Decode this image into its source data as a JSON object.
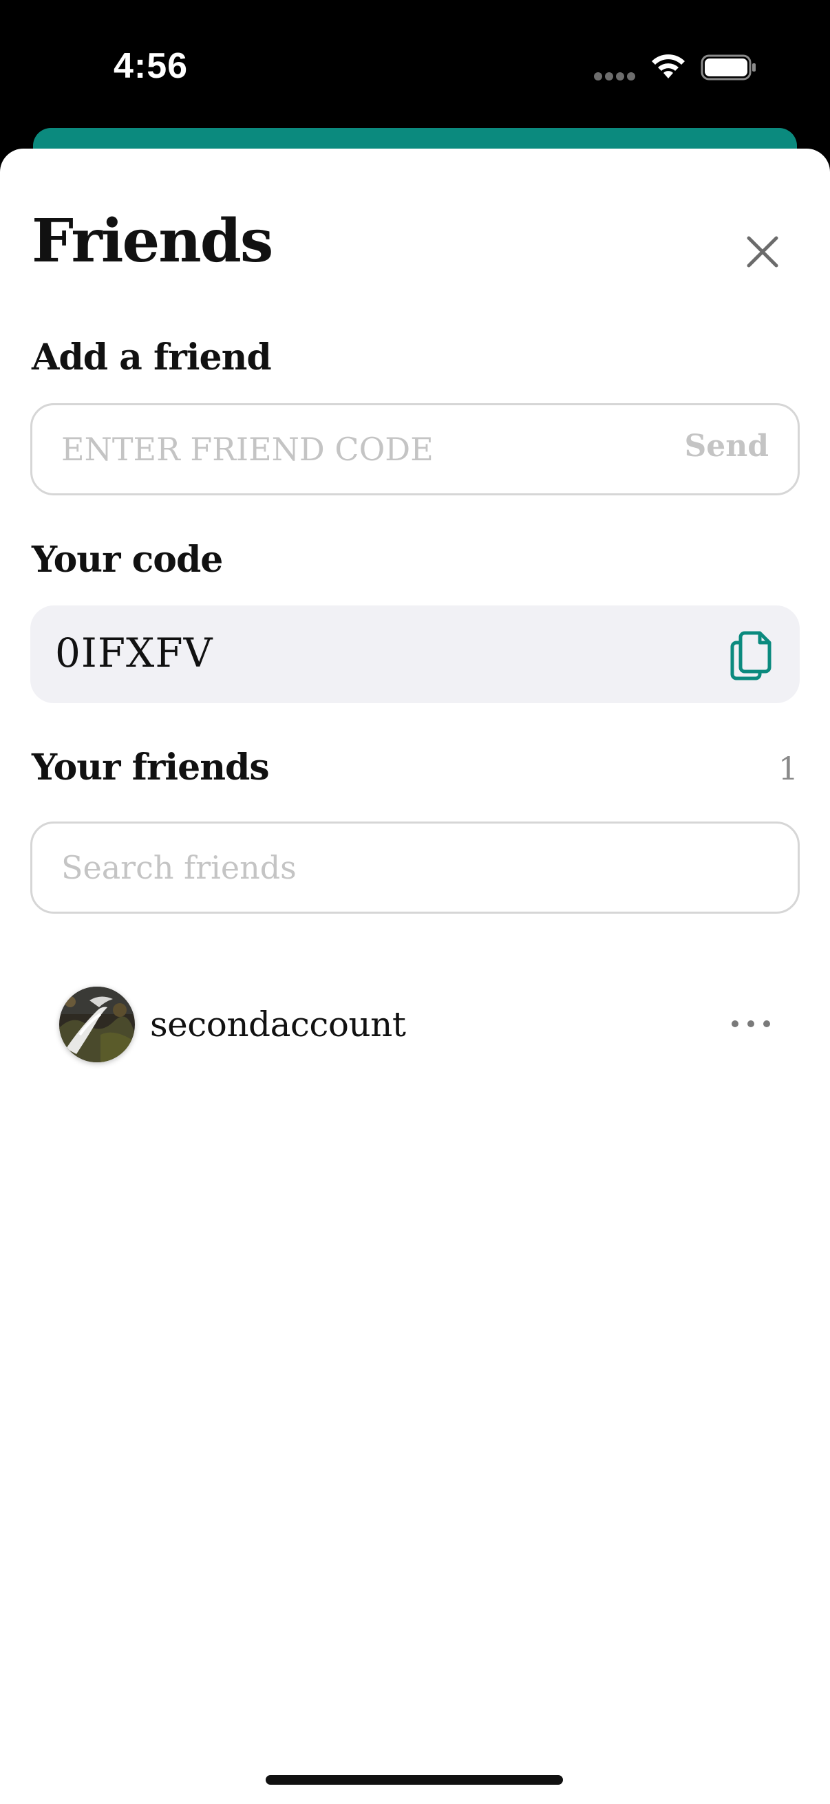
{
  "status_bar": {
    "time": "4:56",
    "signal_icon": "cellular-signal-icon",
    "wifi_icon": "wifi-icon",
    "battery_icon": "battery-icon"
  },
  "sheet": {
    "title": "Friends",
    "close_icon": "close-icon"
  },
  "add_friend": {
    "label": "Add a friend",
    "input_value": "",
    "input_placeholder": "ENTER FRIEND CODE",
    "send_label": "Send"
  },
  "your_code": {
    "label": "Your code",
    "value": "0IFXFV",
    "copy_icon": "copy-icon"
  },
  "your_friends": {
    "label": "Your friends",
    "count": "1",
    "search_value": "",
    "search_placeholder": "Search friends",
    "items": [
      {
        "name": "secondaccount",
        "avatar": "waterfall-photo",
        "more_icon": "more-horizontal-icon"
      }
    ]
  },
  "colors": {
    "accent": "#0b8a7e",
    "placeholder": "#c4c4c4",
    "code_background": "#f1f1f5",
    "text": "#111111"
  }
}
